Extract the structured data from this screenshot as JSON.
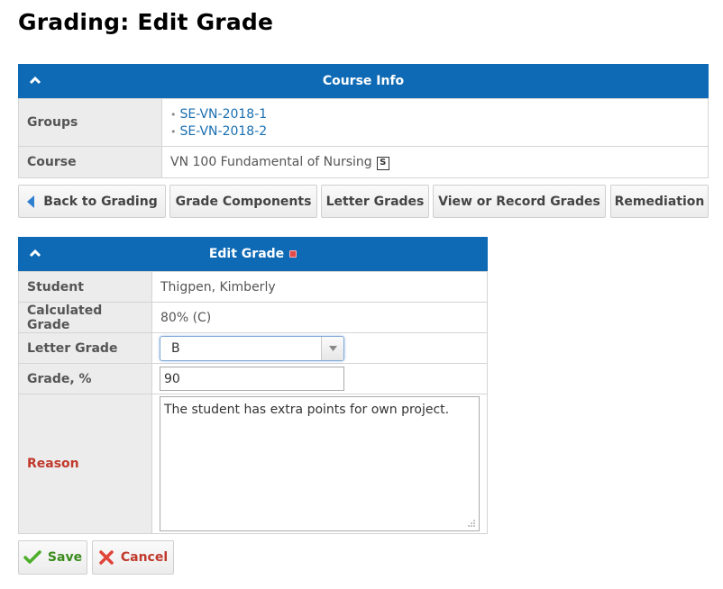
{
  "page": {
    "title": "Grading: Edit Grade"
  },
  "course_info": {
    "header": "Course Info",
    "groups_label": "Groups",
    "groups": [
      "SE-VN-2018-1",
      "SE-VN-2018-2"
    ],
    "course_label": "Course",
    "course_value": "VN 100 Fundamental of Nursing",
    "course_badge": "S"
  },
  "nav": {
    "back": "Back to Grading",
    "grade_components": "Grade Components",
    "letter_grades": "Letter Grades",
    "view_record": "View or Record Grades",
    "remediation": "Remediation"
  },
  "edit_grade": {
    "header": "Edit Grade",
    "student_label": "Student",
    "student_value": "Thigpen, Kimberly",
    "calculated_label": "Calculated Grade",
    "calculated_value": "80% (C)",
    "letter_label": "Letter Grade",
    "letter_value": "B",
    "percent_label": "Grade, %",
    "percent_value": "90",
    "reason_label": "Reason",
    "reason_value": "The student has extra points for own project."
  },
  "actions": {
    "save": "Save",
    "cancel": "Cancel"
  },
  "colors": {
    "header_blue": "#0e6ab5",
    "link_blue": "#1a6fb0",
    "reason_red": "#c0392b",
    "save_green": "#3c8c1e",
    "cancel_red": "#c0392b"
  }
}
